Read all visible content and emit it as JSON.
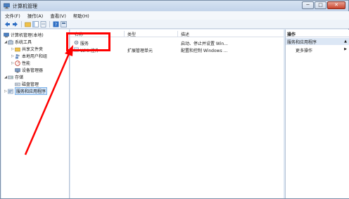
{
  "window": {
    "title": "计算机管理",
    "controls": {
      "minimize": "─",
      "maximize": "□",
      "close": "✕"
    }
  },
  "menubar": {
    "items": [
      "文件(F)",
      "操作(A)",
      "查看(V)",
      "帮助(H)"
    ]
  },
  "tree": {
    "root": "计算机管理(本地)",
    "system_tools": "系统工具",
    "shared_folders": "共享文件夹",
    "local_users": "本地用户和组",
    "performance": "性能",
    "device_manager": "设备管理器",
    "storage": "存储",
    "disk_management": "磁盘管理",
    "services_apps": "服务和应用程序"
  },
  "list": {
    "headers": {
      "name": "名称",
      "type": "类型",
      "description": "描述"
    },
    "rows": [
      {
        "name": "服务",
        "type": "",
        "description": "启动、停止并设置 Win..."
      },
      {
        "name": "WMI 控件",
        "type": "扩展管理单元",
        "description": "配置和控制 Windows ..."
      }
    ]
  },
  "actions": {
    "header": "操作",
    "section": "服务和应用程序",
    "more": "更多操作"
  },
  "colors": {
    "annotation": "#ff0000",
    "selection": "#cfe3fa"
  }
}
